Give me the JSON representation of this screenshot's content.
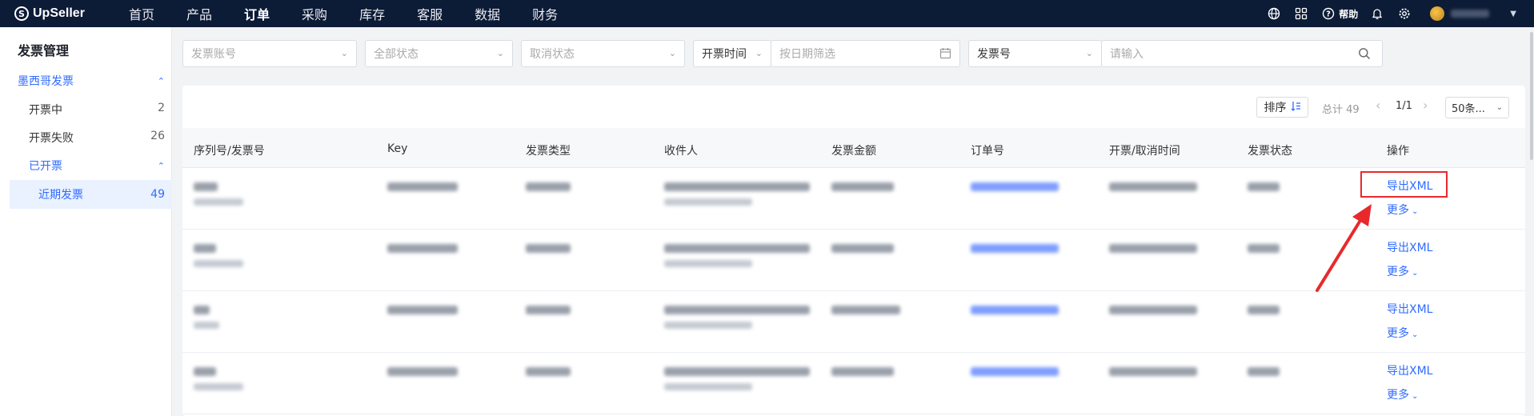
{
  "app": {
    "logo_text": "UpSeller"
  },
  "nav": {
    "items": [
      "首页",
      "产品",
      "订单",
      "采购",
      "库存",
      "客服",
      "数据",
      "财务"
    ],
    "active": "订单",
    "help_label": "帮助"
  },
  "sidebar": {
    "title": "发票管理",
    "group": "墨西哥发票",
    "items": [
      {
        "label": "开票中",
        "count": "2"
      },
      {
        "label": "开票失败",
        "count": "26"
      }
    ],
    "subgroup": "已开票",
    "active_item": {
      "label": "近期发票",
      "count": "49"
    }
  },
  "filters": {
    "account_placeholder": "发票账号",
    "status_placeholder": "全部状态",
    "cancel_status_placeholder": "取消状态",
    "time_type": "开票时间",
    "date_placeholder": "按日期筛选",
    "search_type": "发票号",
    "search_placeholder": "请输入"
  },
  "toolbar": {
    "sort_label": "排序",
    "total_label": "总计 49",
    "page_label": "1/1",
    "per_page": "50条..."
  },
  "table": {
    "columns": [
      "序列号/发票号",
      "Key",
      "发票类型",
      "收件人",
      "发票金额",
      "订单号",
      "开票/取消时间",
      "发票状态",
      "操作"
    ],
    "action_label": "导出XML",
    "more_label": "更多",
    "row_count": 4
  },
  "colors": {
    "nav_bg": "#0c1b36",
    "accent": "#2f6bff",
    "highlight": "#e8292c"
  }
}
